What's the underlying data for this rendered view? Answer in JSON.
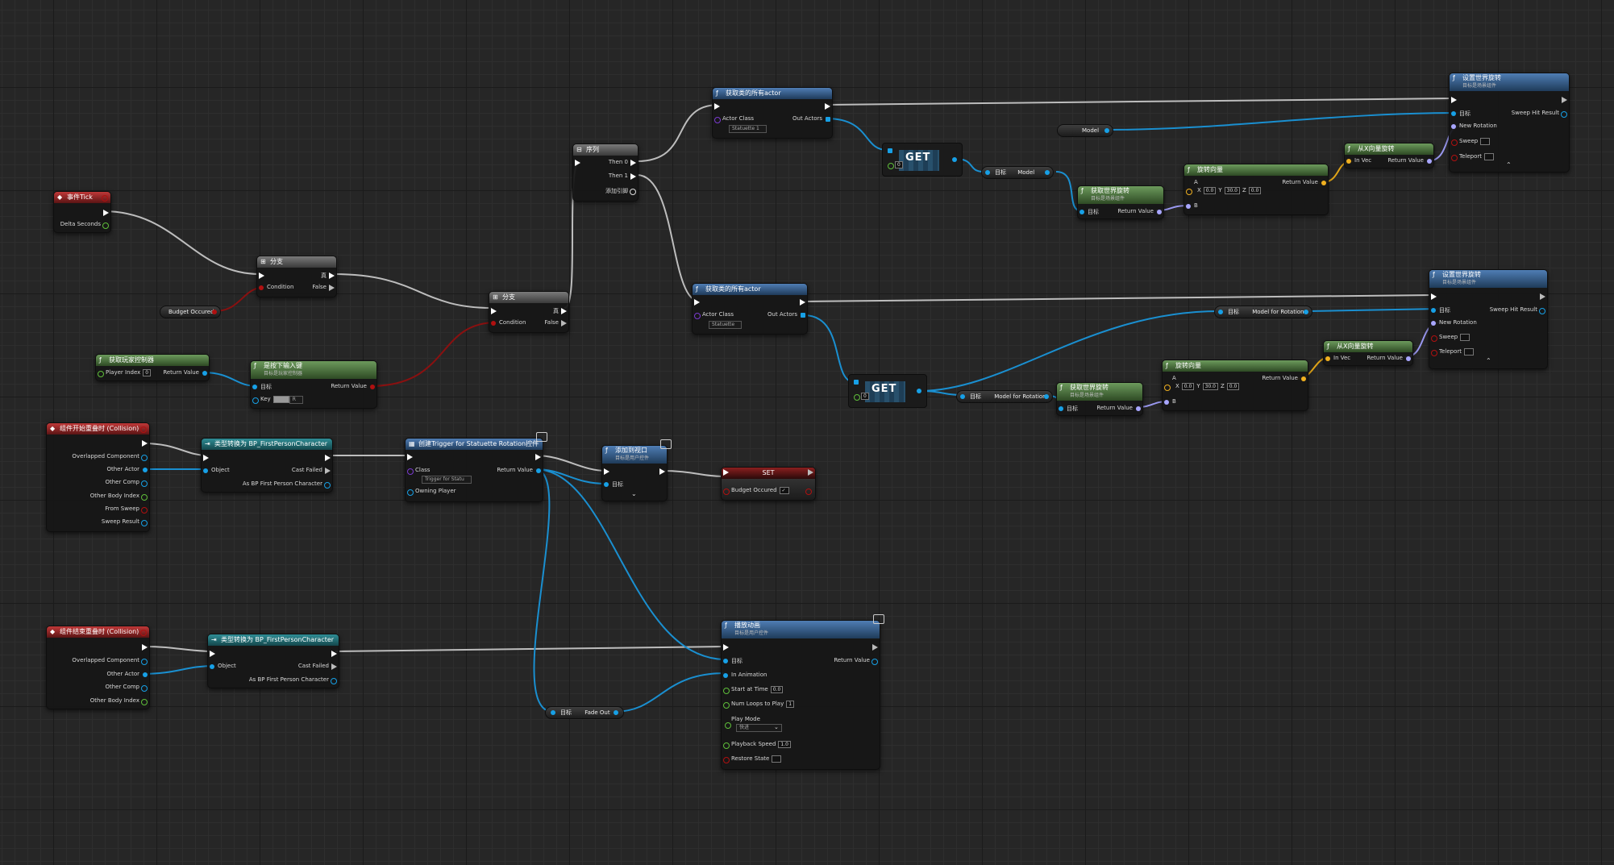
{
  "nodes": {
    "tick": {
      "title": "事件Tick",
      "delta": "Delta Seconds"
    },
    "branch1": {
      "title": "分支",
      "true": "真",
      "condition": "Condition",
      "false": "False"
    },
    "branch2": {
      "title": "分支",
      "true": "真",
      "condition": "Condition",
      "false": "False"
    },
    "budget_var": {
      "label": "Budget Occured"
    },
    "get_controller": {
      "title": "获取玩家控制器",
      "player_index": "Player Index",
      "player_index_val": "0",
      "ret": "Return Value"
    },
    "key_down": {
      "title": "是按下输入键",
      "sub": "目标是玩家控制器",
      "target": "目标",
      "key": "Key",
      "key_val": "R",
      "ret": "Return Value"
    },
    "sequence": {
      "title": "序列",
      "then0": "Then 0",
      "then1": "Then 1",
      "add": "添加引脚"
    },
    "get_all_1": {
      "title": "获取类的所有actor",
      "class": "Actor Class",
      "class_val": "Statuette 1",
      "out": "Out Actors"
    },
    "get_all_2": {
      "title": "获取类的所有actor",
      "class": "Actor Class",
      "class_val": "Statuette",
      "out": "Out Actors"
    },
    "get1": {
      "label": "GET",
      "idx": "0"
    },
    "get2": {
      "label": "GET",
      "idx": "0"
    },
    "model_var": {
      "label": "Model"
    },
    "target_model": {
      "target": "目标",
      "model": "Model"
    },
    "target_model_rot": {
      "target": "目标",
      "model": "Model for Rotation"
    },
    "target_model_rot_top": {
      "target": "目标",
      "model": "Model for Rotation"
    },
    "get_rot_1": {
      "title": "获取世界旋转",
      "sub": "目标是场景组件",
      "target": "目标",
      "ret": "Return Value"
    },
    "get_rot_2": {
      "title": "获取世界旋转",
      "sub": "目标是场景组件",
      "target": "目标",
      "ret": "Return Value"
    },
    "rotate_vec_1": {
      "title": "旋转向量",
      "a": "A",
      "x": "0.0",
      "y": "30.0",
      "z": "0.0",
      "b": "B",
      "ret": "Return Value"
    },
    "rotate_vec_2": {
      "title": "旋转向量",
      "a": "A",
      "x": "0.0",
      "y": "30.0",
      "z": "0.0",
      "b": "B",
      "ret": "Return Value"
    },
    "rot_from_vec_1": {
      "title": "从X向量旋转",
      "in": "In Vec",
      "ret": "Return Value"
    },
    "rot_from_vec_2": {
      "title": "从X向量旋转",
      "in": "In Vec",
      "ret": "Return Value"
    },
    "set_rot_1": {
      "title": "设置世界旋转",
      "sub": "目标是场景组件",
      "target": "目标",
      "sweep_hit": "Sweep Hit Result",
      "new_rot": "New Rotation",
      "sweep": "Sweep",
      "teleport": "Teleport"
    },
    "set_rot_2": {
      "title": "设置世界旋转",
      "sub": "目标是场景组件",
      "target": "目标",
      "sweep_hit": "Sweep Hit Result",
      "new_rot": "New Rotation",
      "sweep": "Sweep",
      "teleport": "Teleport"
    },
    "overlap_begin": {
      "title": "组件开始重叠时 (Collision)",
      "pins": [
        "Overlapped Component",
        "Other Actor",
        "Other Comp",
        "Other Body Index",
        "From Sweep",
        "Sweep Result"
      ]
    },
    "overlap_end": {
      "title": "组件结束重叠时 (Collision)",
      "pins": [
        "Overlapped Component",
        "Other Actor",
        "Other Comp",
        "Other Body Index"
      ]
    },
    "cast_1": {
      "title": "类型转换为 BP_FirstPersonCharacter",
      "object": "Object",
      "failed": "Cast Failed",
      "as": "As BP First Person Character"
    },
    "cast_2": {
      "title": "类型转换为 BP_FirstPersonCharacter",
      "object": "Object",
      "failed": "Cast Failed",
      "as": "As BP First Person Character"
    },
    "create_widget": {
      "title": "创建Trigger for Statuette Rotation控件",
      "class": "Class",
      "class_val": "Trigger for Statu",
      "ret": "Return Value",
      "owner": "Owning Player"
    },
    "add_viewport": {
      "title": "添加到视口",
      "sub": "目标是用户控件",
      "target": "目标"
    },
    "set_node": {
      "title": "SET",
      "label": "Budget Occured"
    },
    "play_anim": {
      "title": "播放动画",
      "sub": "目标是用户控件",
      "target": "目标",
      "in_anim": "In Animation",
      "start": "Start at Time",
      "start_val": "0.0",
      "loops": "Num Loops to Play",
      "loops_val": "1",
      "mode": "Play Mode",
      "mode_val": "快进",
      "speed": "Playback Speed",
      "speed_val": "1.0",
      "restore": "Restore State",
      "ret": "Return Value"
    },
    "fade_out": {
      "target": "目标",
      "label": "Fade Out"
    }
  },
  "colors": {
    "exec": "#ffffff",
    "object": "#17a0e6",
    "bool": "#b01010",
    "rotator": "#a8a6ff",
    "vector": "#f0b020",
    "int": "#5fbf3a",
    "float": "#9be24a"
  }
}
